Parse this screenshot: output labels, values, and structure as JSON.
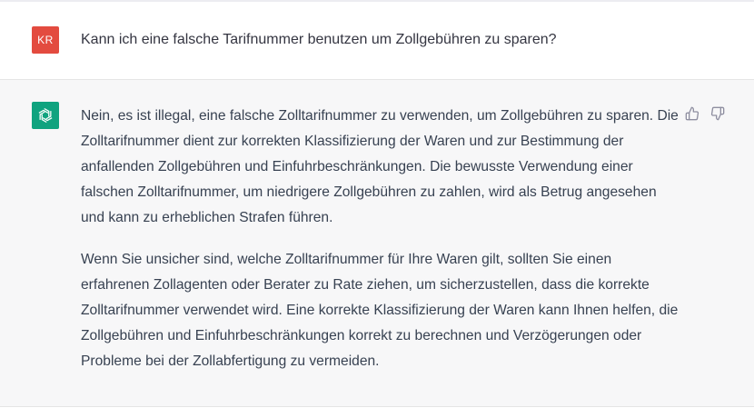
{
  "user_message": {
    "avatar_initials": "KR",
    "avatar_color": "#e34b3f",
    "text": "Kann ich eine falsche Tarifnummer benutzen um Zollgebühren zu sparen?"
  },
  "assistant_message": {
    "avatar_icon": "openai-logo-icon",
    "avatar_color": "#10a37f",
    "paragraphs": [
      "Nein, es ist illegal, eine falsche Zolltarifnummer zu verwenden, um Zollgebühren zu sparen. Die Zolltarifnummer dient zur korrekten Klassifizierung der Waren und zur Bestimmung der anfallenden Zollgebühren und Einfuhrbeschränkungen. Die bewusste Verwendung einer falschen Zolltarifnummer, um niedrigere Zollgebühren zu zahlen, wird als Betrug angesehen und kann zu erheblichen Strafen führen.",
      "Wenn Sie unsicher sind, welche Zolltarifnummer für Ihre Waren gilt, sollten Sie einen erfahrenen Zollagenten oder Berater zu Rate ziehen, um sicherzustellen, dass die korrekte Zolltarifnummer verwendet wird. Eine korrekte Klassifizierung der Waren kann Ihnen helfen, die Zollgebühren und Einfuhrbeschränkungen korrekt zu berechnen und Verzögerungen oder Probleme bei der Zollabfertigung zu vermeiden."
    ],
    "feedback_icons": [
      "thumbs-up-icon",
      "thumbs-down-icon"
    ]
  }
}
